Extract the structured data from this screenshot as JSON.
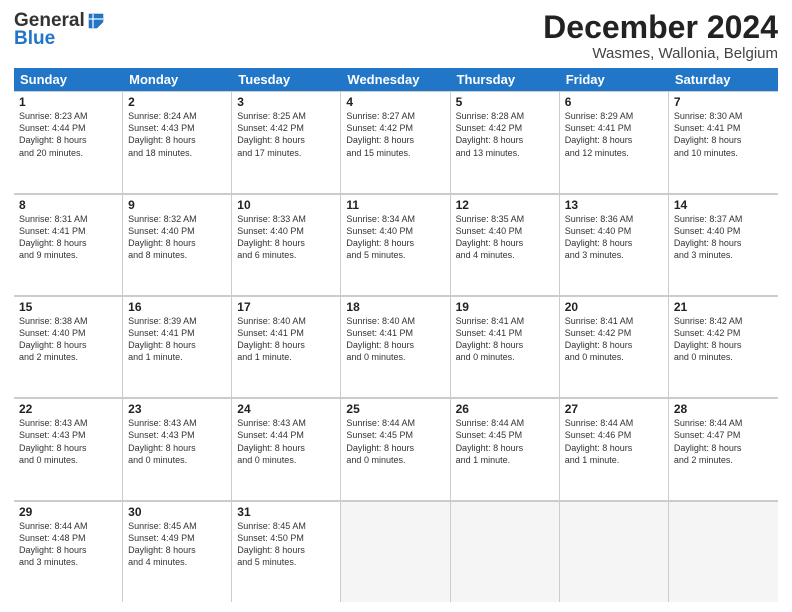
{
  "header": {
    "logo_general": "General",
    "logo_blue": "Blue",
    "month_title": "December 2024",
    "location": "Wasmes, Wallonia, Belgium"
  },
  "days_of_week": [
    "Sunday",
    "Monday",
    "Tuesday",
    "Wednesday",
    "Thursday",
    "Friday",
    "Saturday"
  ],
  "weeks": [
    [
      {
        "day": "1",
        "lines": [
          "Sunrise: 8:23 AM",
          "Sunset: 4:44 PM",
          "Daylight: 8 hours",
          "and 20 minutes."
        ]
      },
      {
        "day": "2",
        "lines": [
          "Sunrise: 8:24 AM",
          "Sunset: 4:43 PM",
          "Daylight: 8 hours",
          "and 18 minutes."
        ]
      },
      {
        "day": "3",
        "lines": [
          "Sunrise: 8:25 AM",
          "Sunset: 4:42 PM",
          "Daylight: 8 hours",
          "and 17 minutes."
        ]
      },
      {
        "day": "4",
        "lines": [
          "Sunrise: 8:27 AM",
          "Sunset: 4:42 PM",
          "Daylight: 8 hours",
          "and 15 minutes."
        ]
      },
      {
        "day": "5",
        "lines": [
          "Sunrise: 8:28 AM",
          "Sunset: 4:42 PM",
          "Daylight: 8 hours",
          "and 13 minutes."
        ]
      },
      {
        "day": "6",
        "lines": [
          "Sunrise: 8:29 AM",
          "Sunset: 4:41 PM",
          "Daylight: 8 hours",
          "and 12 minutes."
        ]
      },
      {
        "day": "7",
        "lines": [
          "Sunrise: 8:30 AM",
          "Sunset: 4:41 PM",
          "Daylight: 8 hours",
          "and 10 minutes."
        ]
      }
    ],
    [
      {
        "day": "8",
        "lines": [
          "Sunrise: 8:31 AM",
          "Sunset: 4:41 PM",
          "Daylight: 8 hours",
          "and 9 minutes."
        ]
      },
      {
        "day": "9",
        "lines": [
          "Sunrise: 8:32 AM",
          "Sunset: 4:40 PM",
          "Daylight: 8 hours",
          "and 8 minutes."
        ]
      },
      {
        "day": "10",
        "lines": [
          "Sunrise: 8:33 AM",
          "Sunset: 4:40 PM",
          "Daylight: 8 hours",
          "and 6 minutes."
        ]
      },
      {
        "day": "11",
        "lines": [
          "Sunrise: 8:34 AM",
          "Sunset: 4:40 PM",
          "Daylight: 8 hours",
          "and 5 minutes."
        ]
      },
      {
        "day": "12",
        "lines": [
          "Sunrise: 8:35 AM",
          "Sunset: 4:40 PM",
          "Daylight: 8 hours",
          "and 4 minutes."
        ]
      },
      {
        "day": "13",
        "lines": [
          "Sunrise: 8:36 AM",
          "Sunset: 4:40 PM",
          "Daylight: 8 hours",
          "and 3 minutes."
        ]
      },
      {
        "day": "14",
        "lines": [
          "Sunrise: 8:37 AM",
          "Sunset: 4:40 PM",
          "Daylight: 8 hours",
          "and 3 minutes."
        ]
      }
    ],
    [
      {
        "day": "15",
        "lines": [
          "Sunrise: 8:38 AM",
          "Sunset: 4:40 PM",
          "Daylight: 8 hours",
          "and 2 minutes."
        ]
      },
      {
        "day": "16",
        "lines": [
          "Sunrise: 8:39 AM",
          "Sunset: 4:41 PM",
          "Daylight: 8 hours",
          "and 1 minute."
        ]
      },
      {
        "day": "17",
        "lines": [
          "Sunrise: 8:40 AM",
          "Sunset: 4:41 PM",
          "Daylight: 8 hours",
          "and 1 minute."
        ]
      },
      {
        "day": "18",
        "lines": [
          "Sunrise: 8:40 AM",
          "Sunset: 4:41 PM",
          "Daylight: 8 hours",
          "and 0 minutes."
        ]
      },
      {
        "day": "19",
        "lines": [
          "Sunrise: 8:41 AM",
          "Sunset: 4:41 PM",
          "Daylight: 8 hours",
          "and 0 minutes."
        ]
      },
      {
        "day": "20",
        "lines": [
          "Sunrise: 8:41 AM",
          "Sunset: 4:42 PM",
          "Daylight: 8 hours",
          "and 0 minutes."
        ]
      },
      {
        "day": "21",
        "lines": [
          "Sunrise: 8:42 AM",
          "Sunset: 4:42 PM",
          "Daylight: 8 hours",
          "and 0 minutes."
        ]
      }
    ],
    [
      {
        "day": "22",
        "lines": [
          "Sunrise: 8:43 AM",
          "Sunset: 4:43 PM",
          "Daylight: 8 hours",
          "and 0 minutes."
        ]
      },
      {
        "day": "23",
        "lines": [
          "Sunrise: 8:43 AM",
          "Sunset: 4:43 PM",
          "Daylight: 8 hours",
          "and 0 minutes."
        ]
      },
      {
        "day": "24",
        "lines": [
          "Sunrise: 8:43 AM",
          "Sunset: 4:44 PM",
          "Daylight: 8 hours",
          "and 0 minutes."
        ]
      },
      {
        "day": "25",
        "lines": [
          "Sunrise: 8:44 AM",
          "Sunset: 4:45 PM",
          "Daylight: 8 hours",
          "and 0 minutes."
        ]
      },
      {
        "day": "26",
        "lines": [
          "Sunrise: 8:44 AM",
          "Sunset: 4:45 PM",
          "Daylight: 8 hours",
          "and 1 minute."
        ]
      },
      {
        "day": "27",
        "lines": [
          "Sunrise: 8:44 AM",
          "Sunset: 4:46 PM",
          "Daylight: 8 hours",
          "and 1 minute."
        ]
      },
      {
        "day": "28",
        "lines": [
          "Sunrise: 8:44 AM",
          "Sunset: 4:47 PM",
          "Daylight: 8 hours",
          "and 2 minutes."
        ]
      }
    ],
    [
      {
        "day": "29",
        "lines": [
          "Sunrise: 8:44 AM",
          "Sunset: 4:48 PM",
          "Daylight: 8 hours",
          "and 3 minutes."
        ]
      },
      {
        "day": "30",
        "lines": [
          "Sunrise: 8:45 AM",
          "Sunset: 4:49 PM",
          "Daylight: 8 hours",
          "and 4 minutes."
        ]
      },
      {
        "day": "31",
        "lines": [
          "Sunrise: 8:45 AM",
          "Sunset: 4:50 PM",
          "Daylight: 8 hours",
          "and 5 minutes."
        ]
      },
      null,
      null,
      null,
      null
    ]
  ]
}
